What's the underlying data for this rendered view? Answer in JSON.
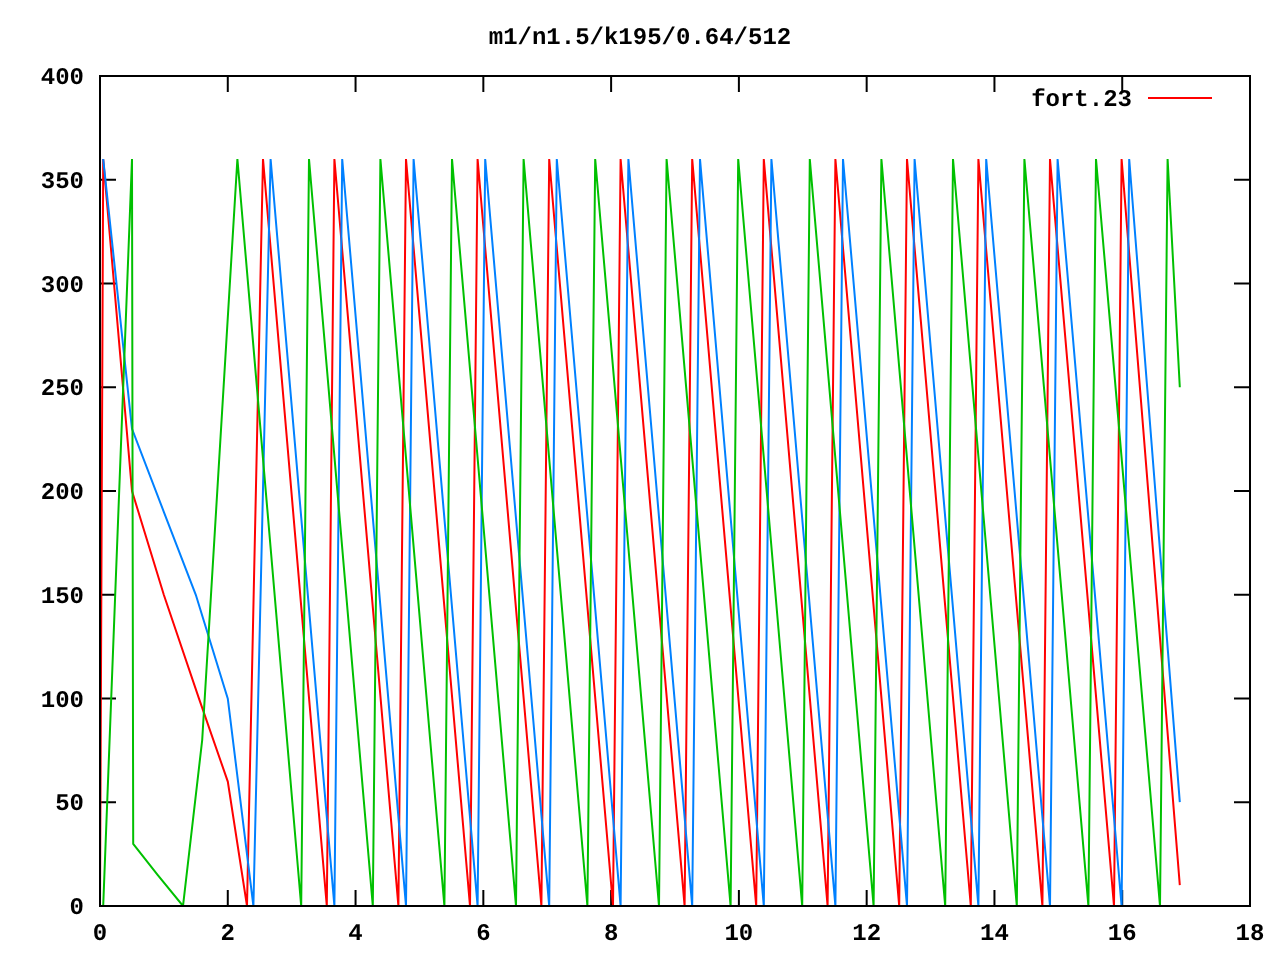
{
  "chart_data": {
    "type": "line",
    "title": "m1/n1.5/k195/0.64/512",
    "xlim": [
      0,
      18
    ],
    "ylim": [
      0,
      400
    ],
    "xticks": [
      0,
      2,
      4,
      6,
      8,
      10,
      12,
      14,
      16,
      18
    ],
    "yticks": [
      0,
      50,
      100,
      150,
      200,
      250,
      300,
      350,
      400
    ],
    "series": [
      {
        "name": "fort.23",
        "color": "#ff0000",
        "x": [
          0,
          0.05,
          0.5,
          1.0,
          1.55,
          2.0,
          2.3,
          2.55,
          3.55,
          3.67,
          4.67,
          4.79,
          5.79,
          5.91,
          6.91,
          7.03,
          8.03,
          8.15,
          9.15,
          9.27,
          10.27,
          10.39,
          11.39,
          11.51,
          12.51,
          12.63,
          13.63,
          13.75,
          14.75,
          14.87,
          15.87,
          15.99,
          16.9
        ],
        "values": [
          0,
          360,
          200,
          150,
          100,
          60,
          0,
          360,
          0,
          360,
          0,
          360,
          0,
          360,
          0,
          360,
          0,
          360,
          0,
          360,
          0,
          360,
          0,
          360,
          0,
          360,
          0,
          360,
          0,
          360,
          0,
          360,
          10
        ]
      },
      {
        "color": "#0080ff",
        "x": [
          0.05,
          0.5,
          1.0,
          1.5,
          2.0,
          2.4,
          2.67,
          3.67,
          3.79,
          4.79,
          4.91,
          5.91,
          6.03,
          7.03,
          7.15,
          8.15,
          8.27,
          9.27,
          9.39,
          10.39,
          10.51,
          11.51,
          11.63,
          12.63,
          12.75,
          13.75,
          13.87,
          14.87,
          14.99,
          15.99,
          16.11,
          16.9
        ],
        "values": [
          360,
          230,
          190,
          150,
          100,
          0,
          360,
          0,
          360,
          0,
          360,
          0,
          360,
          0,
          360,
          0,
          360,
          0,
          360,
          0,
          360,
          0,
          360,
          0,
          360,
          0,
          360,
          0,
          360,
          0,
          360,
          50
        ]
      },
      {
        "color": "#00c000",
        "x": [
          0.05,
          0.5,
          0.52,
          0.9,
          1.3,
          1.6,
          2.15,
          3.15,
          3.27,
          4.27,
          4.39,
          5.39,
          5.51,
          6.51,
          6.63,
          7.63,
          7.75,
          8.75,
          8.87,
          9.87,
          9.99,
          10.99,
          11.11,
          12.11,
          12.23,
          13.23,
          13.35,
          14.35,
          14.47,
          15.47,
          15.59,
          16.59,
          16.71,
          16.9
        ],
        "values": [
          0,
          360,
          30,
          15,
          0,
          80,
          360,
          0,
          360,
          0,
          360,
          0,
          360,
          0,
          360,
          0,
          360,
          0,
          360,
          0,
          360,
          0,
          360,
          0,
          360,
          0,
          360,
          0,
          360,
          0,
          360,
          0,
          360,
          250
        ]
      }
    ]
  }
}
